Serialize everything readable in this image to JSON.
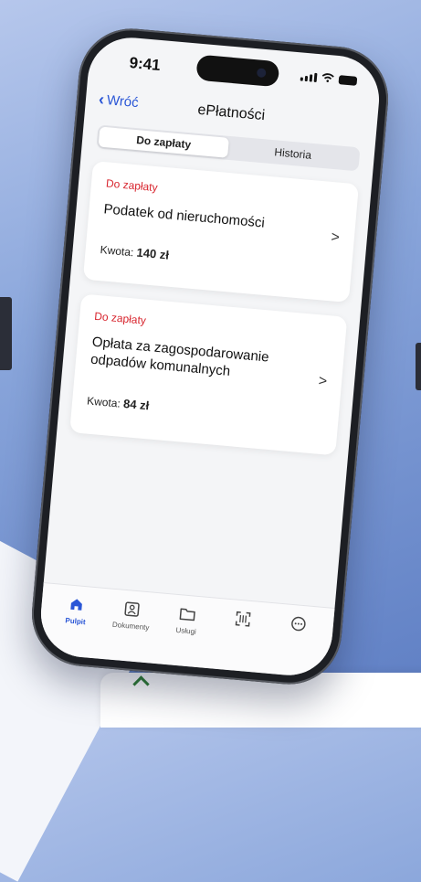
{
  "status_bar": {
    "time": "9:41"
  },
  "nav": {
    "back_label": "Wróć",
    "title": "ePłatności"
  },
  "segments": [
    {
      "label": "Do zapłaty",
      "active": true
    },
    {
      "label": "Historia",
      "active": false
    }
  ],
  "cards": [
    {
      "status": "Do zapłaty",
      "title": "Podatek od nieruchomości",
      "amount_label": "Kwota:",
      "amount": "140 zł"
    },
    {
      "status": "Do zapłaty",
      "title": "Opłata za zagospodarowanie odpadów komunalnych",
      "amount_label": "Kwota:",
      "amount": "84 zł"
    }
  ],
  "tabs": [
    {
      "label": "Pulpit",
      "icon": "home-icon",
      "active": true
    },
    {
      "label": "Dokumenty",
      "icon": "documents-icon",
      "active": false
    },
    {
      "label": "Usługi",
      "icon": "folder-icon",
      "active": false
    },
    {
      "label": "",
      "icon": "qr-scan-icon",
      "active": false
    },
    {
      "label": "",
      "icon": "more-icon",
      "active": false
    }
  ],
  "colors": {
    "accent": "#2a56d6",
    "status_due": "#d8262f"
  }
}
